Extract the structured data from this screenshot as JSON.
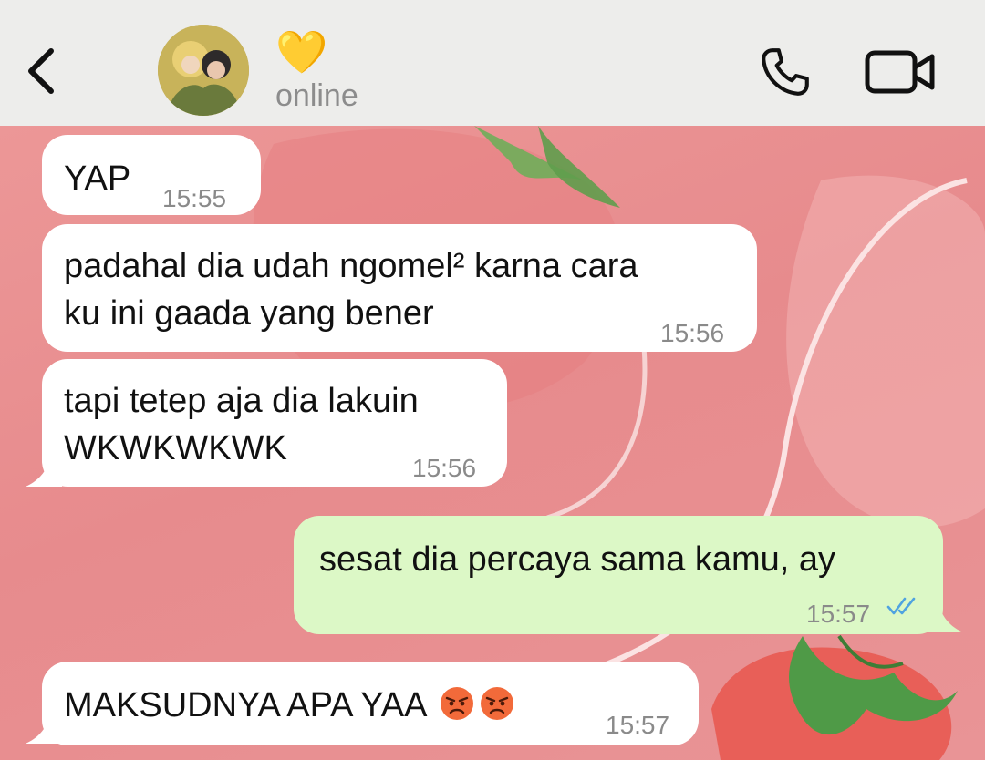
{
  "header": {
    "contact_name": "💛",
    "status": "online"
  },
  "messages": [
    {
      "direction": "in",
      "lines": [
        "YAP"
      ],
      "time": "15:55"
    },
    {
      "direction": "in",
      "lines": [
        "padahal dia udah ngomel² karna cara",
        "ku ini gaada yang bener"
      ],
      "time": "15:56"
    },
    {
      "direction": "in",
      "lines": [
        "tapi tetep aja dia lakuin",
        "WKWKWKWK"
      ],
      "time": "15:56"
    },
    {
      "direction": "out",
      "lines": [
        "sesat dia percaya sama kamu, ay"
      ],
      "time": "15:57",
      "receipt": "read-double-check-icon"
    },
    {
      "direction": "in",
      "lines": [
        "MAKSUDNYA APA YAA"
      ],
      "time": "15:57",
      "emoji": [
        "angry-face-icon",
        "angry-face-icon"
      ]
    }
  ],
  "colors": {
    "header_bg": "#ededeb",
    "incoming_bubble": "#ffffff",
    "outgoing_bubble": "#dcf8c6",
    "wallpaper": "#e8888a",
    "read_ticks": "#4fa3e0"
  },
  "icons": [
    "back-chevron-icon",
    "voice-call-icon",
    "video-call-icon"
  ]
}
